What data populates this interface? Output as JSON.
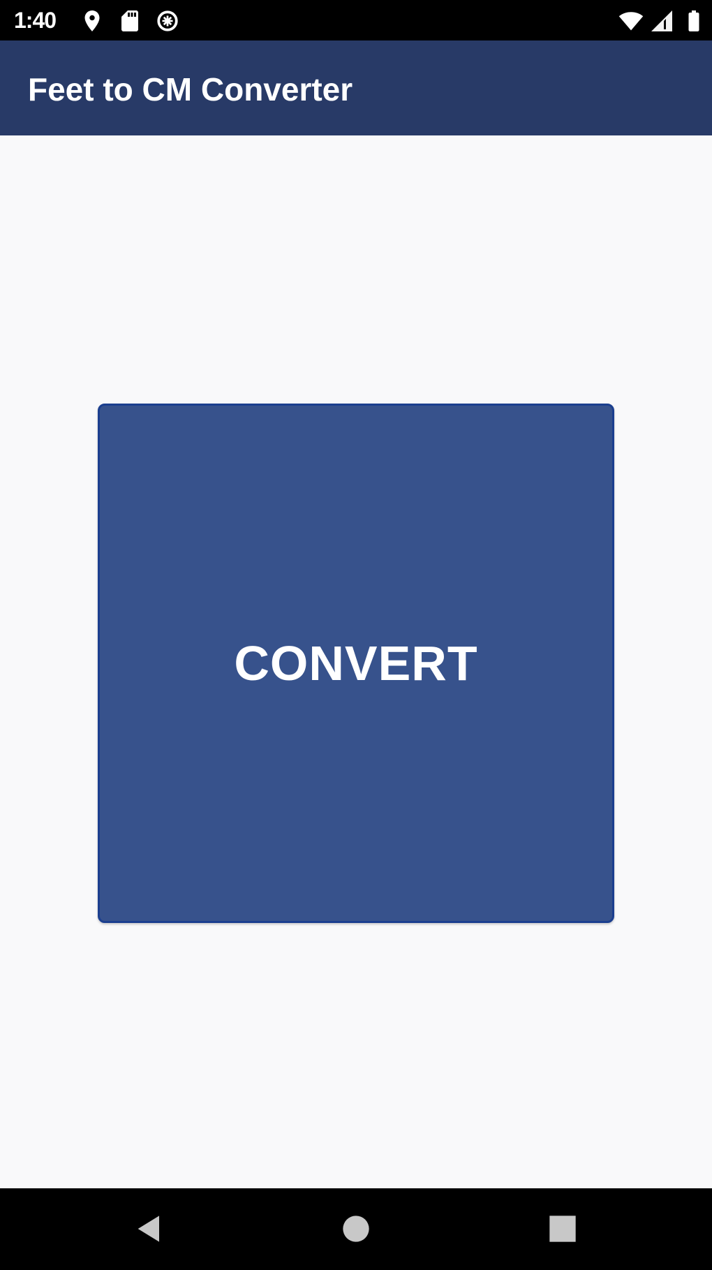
{
  "status_bar": {
    "time": "1:40",
    "icons": [
      "location-icon",
      "sd-card-icon",
      "data-saver-icon",
      "wifi-icon",
      "cell-signal-icon",
      "battery-icon"
    ]
  },
  "app_bar": {
    "title": "Feet to CM Converter"
  },
  "main": {
    "convert_button_label": "CONVERT"
  },
  "nav_bar": {
    "buttons": [
      "back-icon",
      "home-icon",
      "recents-icon"
    ]
  },
  "colors": {
    "app_bar": "#283a67",
    "button": "#37528c",
    "button_border": "#1b3f8f",
    "background": "#f9f9fa"
  }
}
